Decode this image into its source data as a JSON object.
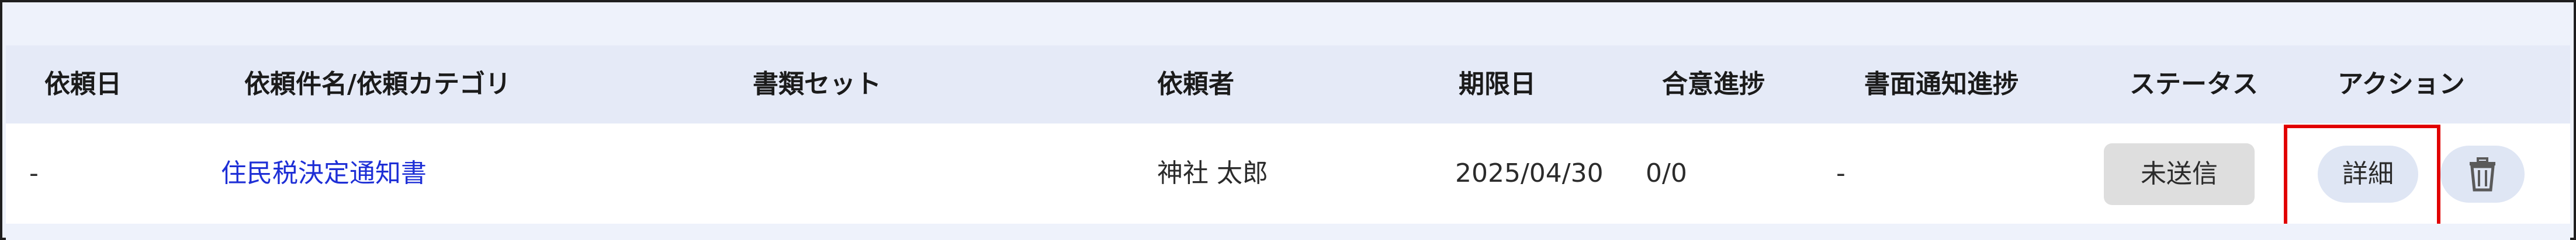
{
  "table": {
    "headers": [
      "依頼日",
      "依頼件名/依頼カテゴリ",
      "書類セット",
      "依頼者",
      "期限日",
      "合意進捗",
      "書面通知進捗",
      "ステータス",
      "アクション"
    ],
    "rows": [
      {
        "request_date": "-",
        "title": "住民税決定通知書",
        "document_set": "",
        "requester": "神社 太郎",
        "due_date": "2025/04/30",
        "agreement_progress": "0/0",
        "notice_progress": "-",
        "status": "未送信",
        "actions": {
          "detail_label": "詳細",
          "delete_icon": "trash-icon"
        }
      }
    ]
  },
  "colors": {
    "header_bg": "#e5eaf7",
    "link": "#1e2fd6",
    "status_bg": "#dedede",
    "action_bg": "#dfe6f4",
    "highlight": "#e10000"
  }
}
